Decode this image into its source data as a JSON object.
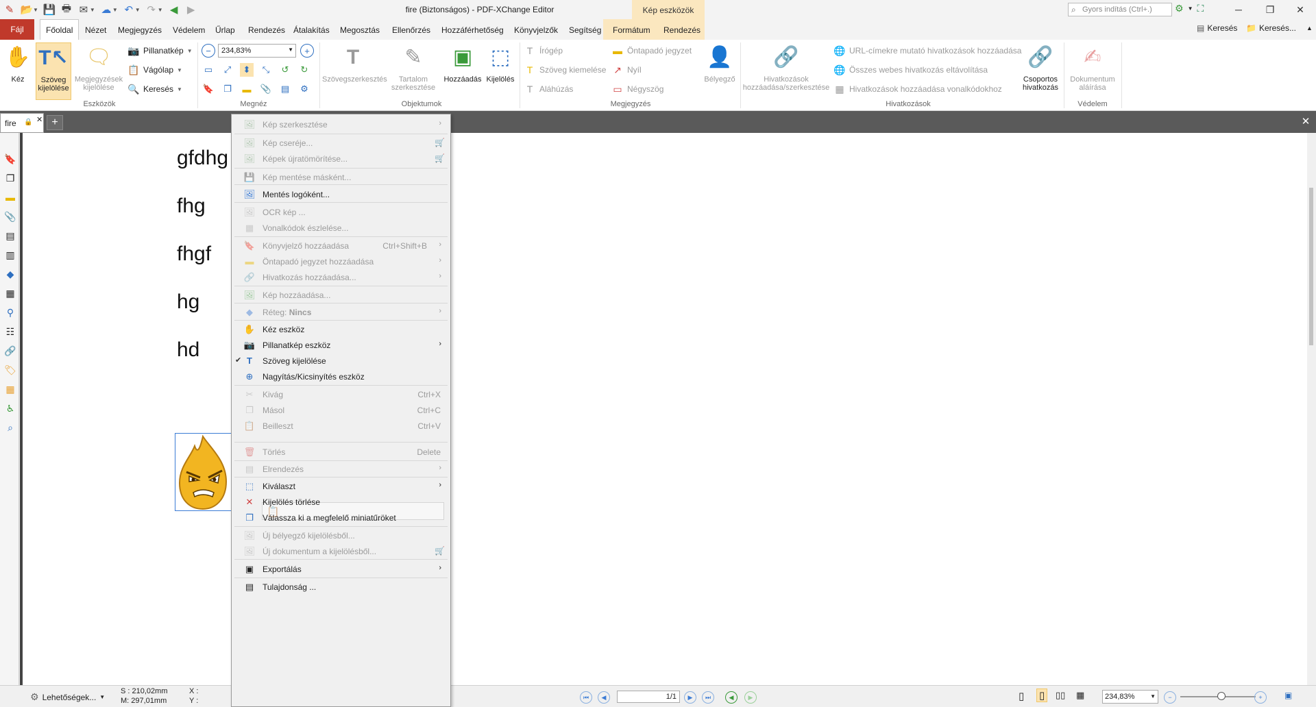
{
  "titlebar": {
    "title": "fire (Biztonságos) - PDF-XChange Editor",
    "context_tab_title": "Kép eszközök",
    "quick_launch_placeholder": "Gyors indítás (Ctrl+.)"
  },
  "menubar": {
    "file": "Fájl",
    "tabs": [
      "Főoldal",
      "Nézet",
      "Megjegyzés",
      "Védelem",
      "Űrlap",
      "Rendezés",
      "Átalakítás",
      "Megosztás",
      "Ellenőrzés",
      "Hozzáférhetőség",
      "Könyvjelzők",
      "Segítség",
      "Formátum",
      "Rendezés"
    ],
    "search1": "Keresés",
    "search2": "Keresés..."
  },
  "ribbon": {
    "hand": "Kéz",
    "select_text_1": "Szöveg",
    "select_text_2": "kijelölése",
    "select_comments_1": "Megjegyzések",
    "select_comments_2": "kijelölése",
    "snapshot": "Pillanatkép",
    "clipboard": "Vágólap",
    "find": "Keresés",
    "group_tools": "Eszközök",
    "zoom_value": "234,83%",
    "group_view": "Megnéz",
    "edit_text": "Szövegszerkesztés",
    "edit_content_1": "Tartalom",
    "edit_content_2": "szerkesztése",
    "add": "Hozzáadás",
    "select": "Kijelölés",
    "group_objects": "Objektumok",
    "typewriter": "Írógép",
    "highlight": "Szöveg kiemelése",
    "underline": "Aláhúzás",
    "sticky_note": "Öntapadó jegyzet",
    "arrow": "Nyíl",
    "rectangle": "Négyszög",
    "stamp": "Bélyegző",
    "group_comment": "Megjegyzés",
    "links_add_1": "Hivatkozások",
    "links_add_2": "hozzáadása/szerkesztése",
    "url_links": "URL-címekre mutató hivatkozások hozzáadása",
    "remove_links": "Összes webes hivatkozás eltávolítása",
    "barcode_links": "Hivatkozások hozzáadása vonalkódokhoz",
    "group_links": "Hivatkozások",
    "batch_links_1": "Csoportos",
    "batch_links_2": "hivatkozás",
    "sign_1": "Dokumentum",
    "sign_2": "aláírása",
    "group_protect": "Védelem"
  },
  "tabstrip": {
    "doc_tab": "fire"
  },
  "document": {
    "lines": [
      "gfdhg",
      "fhg",
      "fhgf",
      "hg",
      "hd"
    ]
  },
  "statusbar": {
    "options": "Lehetőségek...",
    "size_w": "S : 210,02mm",
    "size_h": "M: 297,01mm",
    "x": "X :",
    "y": "Y :",
    "page": "1/1",
    "zoom": "234,83%"
  },
  "context_menu": {
    "items": [
      {
        "label": "Kép szerkesztése",
        "disabled": true
      },
      {
        "label": "Kép cseréje...",
        "disabled": true
      },
      {
        "label": "Képek újratömörítése...",
        "disabled": true
      },
      {
        "label": "Kép mentése másként...",
        "disabled": true
      },
      {
        "label": "Mentés logóként...",
        "disabled": false
      },
      {
        "label": "OCR kép ...",
        "disabled": true
      },
      {
        "label": "Vonalkódok észlelése...",
        "disabled": true
      },
      {
        "label": "Könyvjelző hozzáadása",
        "shortcut": "Ctrl+Shift+B",
        "disabled": true
      },
      {
        "label": "Öntapadó jegyzet hozzáadása",
        "disabled": true
      },
      {
        "label": "Hivatkozás hozzáadása...",
        "disabled": true
      },
      {
        "label": "Kép hozzáadása...",
        "disabled": true
      },
      {
        "label": "Réteg:",
        "label_bold": "Nincs",
        "disabled": true
      },
      {
        "label": "Kéz eszköz",
        "disabled": false
      },
      {
        "label": "Pillanatkép eszköz",
        "disabled": false
      },
      {
        "label": "Szöveg kijelölése",
        "disabled": false
      },
      {
        "label": "Nagyítás/Kicsinyítés eszköz",
        "disabled": false
      },
      {
        "label": "Kivág",
        "shortcut": "Ctrl+X",
        "disabled": true
      },
      {
        "label": "Másol",
        "shortcut": "Ctrl+C",
        "disabled": true
      },
      {
        "label": "Beilleszt",
        "shortcut": "Ctrl+V",
        "disabled": true
      },
      {
        "label": "Törlés",
        "shortcut": "Delete",
        "disabled": true
      },
      {
        "label": "Elrendezés",
        "disabled": true
      },
      {
        "label": "Kiválaszt",
        "disabled": false
      },
      {
        "label": "Kijelölés törlése",
        "disabled": false
      },
      {
        "label": "Válassza ki a megfelelő miniatűröket",
        "disabled": false
      },
      {
        "label": "Új bélyegző kijelölésből...",
        "disabled": true
      },
      {
        "label": "Új dokumentum a kijelölésből...",
        "disabled": true
      },
      {
        "label": "Exportálás",
        "disabled": false
      },
      {
        "label": "Tulajdonság ...",
        "disabled": false
      }
    ]
  }
}
